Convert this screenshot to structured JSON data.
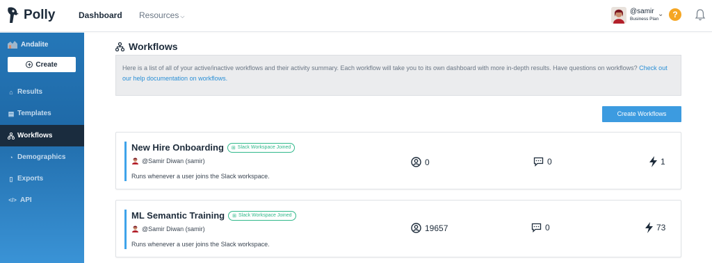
{
  "header": {
    "brand": "Polly",
    "nav": {
      "dashboard": "Dashboard",
      "resources": "Resources"
    },
    "user": {
      "handle": "@samir",
      "plan": "Business Plan"
    },
    "help_label": "?"
  },
  "sidebar": {
    "org_name": "Andalite",
    "create_label": "Create",
    "items": [
      {
        "label": "Results",
        "icon": "home-icon"
      },
      {
        "label": "Templates",
        "icon": "template-icon"
      },
      {
        "label": "Workflows",
        "icon": "workflow-icon",
        "active": true
      },
      {
        "label": "Demographics",
        "icon": "pie-icon"
      },
      {
        "label": "Exports",
        "icon": "file-icon"
      },
      {
        "label": "API",
        "icon": "code-icon"
      }
    ]
  },
  "main": {
    "title": "Workflows",
    "info_text": "Here is a list of all of your active/inactive workflows and their activity summary. Each workflow will take you to its own dashboard with more in-depth results. Have questions on workflows?",
    "info_link": "Check out our help documentation on workflows.",
    "create_button": "Create Workflows",
    "workflows": [
      {
        "title": "New Hire Onboarding",
        "badge": "Slack Workspace Joined",
        "owner": "@Samir Diwan (samir)",
        "description": "Runs whenever a user joins the Slack workspace.",
        "participants": "0",
        "responses": "0",
        "runs": "1"
      },
      {
        "title": "ML Semantic Training",
        "badge": "Slack Workspace Joined",
        "owner": "@Samir Diwan (samir)",
        "description": "Runs whenever a user joins the Slack workspace.",
        "participants": "19657",
        "responses": "0",
        "runs": "73"
      }
    ]
  },
  "colors": {
    "accent": "#3c9be0",
    "sidebar_active": "#1a2c3e",
    "badge_green": "#2fb88a",
    "help_orange": "#f5a623"
  }
}
